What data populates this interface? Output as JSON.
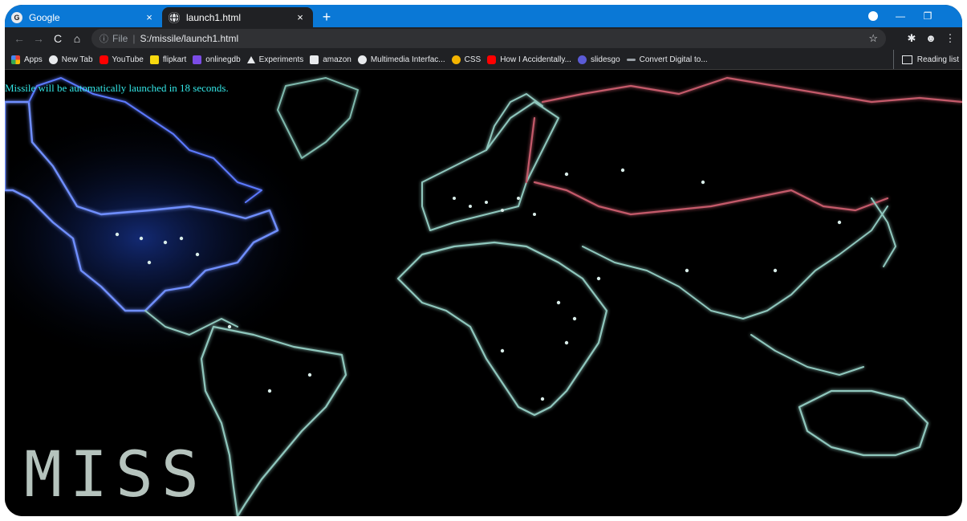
{
  "browser": {
    "tabs": [
      {
        "title": "Google",
        "favicon": "G",
        "active": false,
        "close": "×"
      },
      {
        "title": "launch1.html",
        "favicon": "globe",
        "active": true,
        "close": "×"
      }
    ],
    "new_tab": "+",
    "omnibox": {
      "info_icon": "ⓘ",
      "scheme_label": "File",
      "separator": "|",
      "url": "S:/missile/launch1.html",
      "star_icon": "☆"
    }
  },
  "bookmarks": {
    "items": [
      {
        "label": "Apps",
        "color": "#e94235"
      },
      {
        "label": "New Tab",
        "color": "#e8eaed"
      },
      {
        "label": "YouTube",
        "color": "#ff0000"
      },
      {
        "label": "flipkart",
        "color": "#f8d90f"
      },
      {
        "label": "onlinegdb",
        "color": "#7b4ce6"
      },
      {
        "label": "Experiments",
        "color": "#e8eaed"
      },
      {
        "label": "amazon",
        "color": "#e8eaed"
      },
      {
        "label": "Multimedia Interfac...",
        "color": "#e8eaed"
      },
      {
        "label": "CSS",
        "color": "#f4b400"
      },
      {
        "label": "How I Accidentally...",
        "color": "#ff0000"
      },
      {
        "label": "slidesgo",
        "color": "#5b5bd6"
      },
      {
        "label": "Convert Digital to...",
        "color": "#9aa0a6"
      }
    ],
    "reading_list": "Reading list"
  },
  "page": {
    "countdown_text": "Missile will be automatically launched in 18 seconds.",
    "countdown_color": "#33e6e6",
    "title_overlay": "MISS"
  }
}
